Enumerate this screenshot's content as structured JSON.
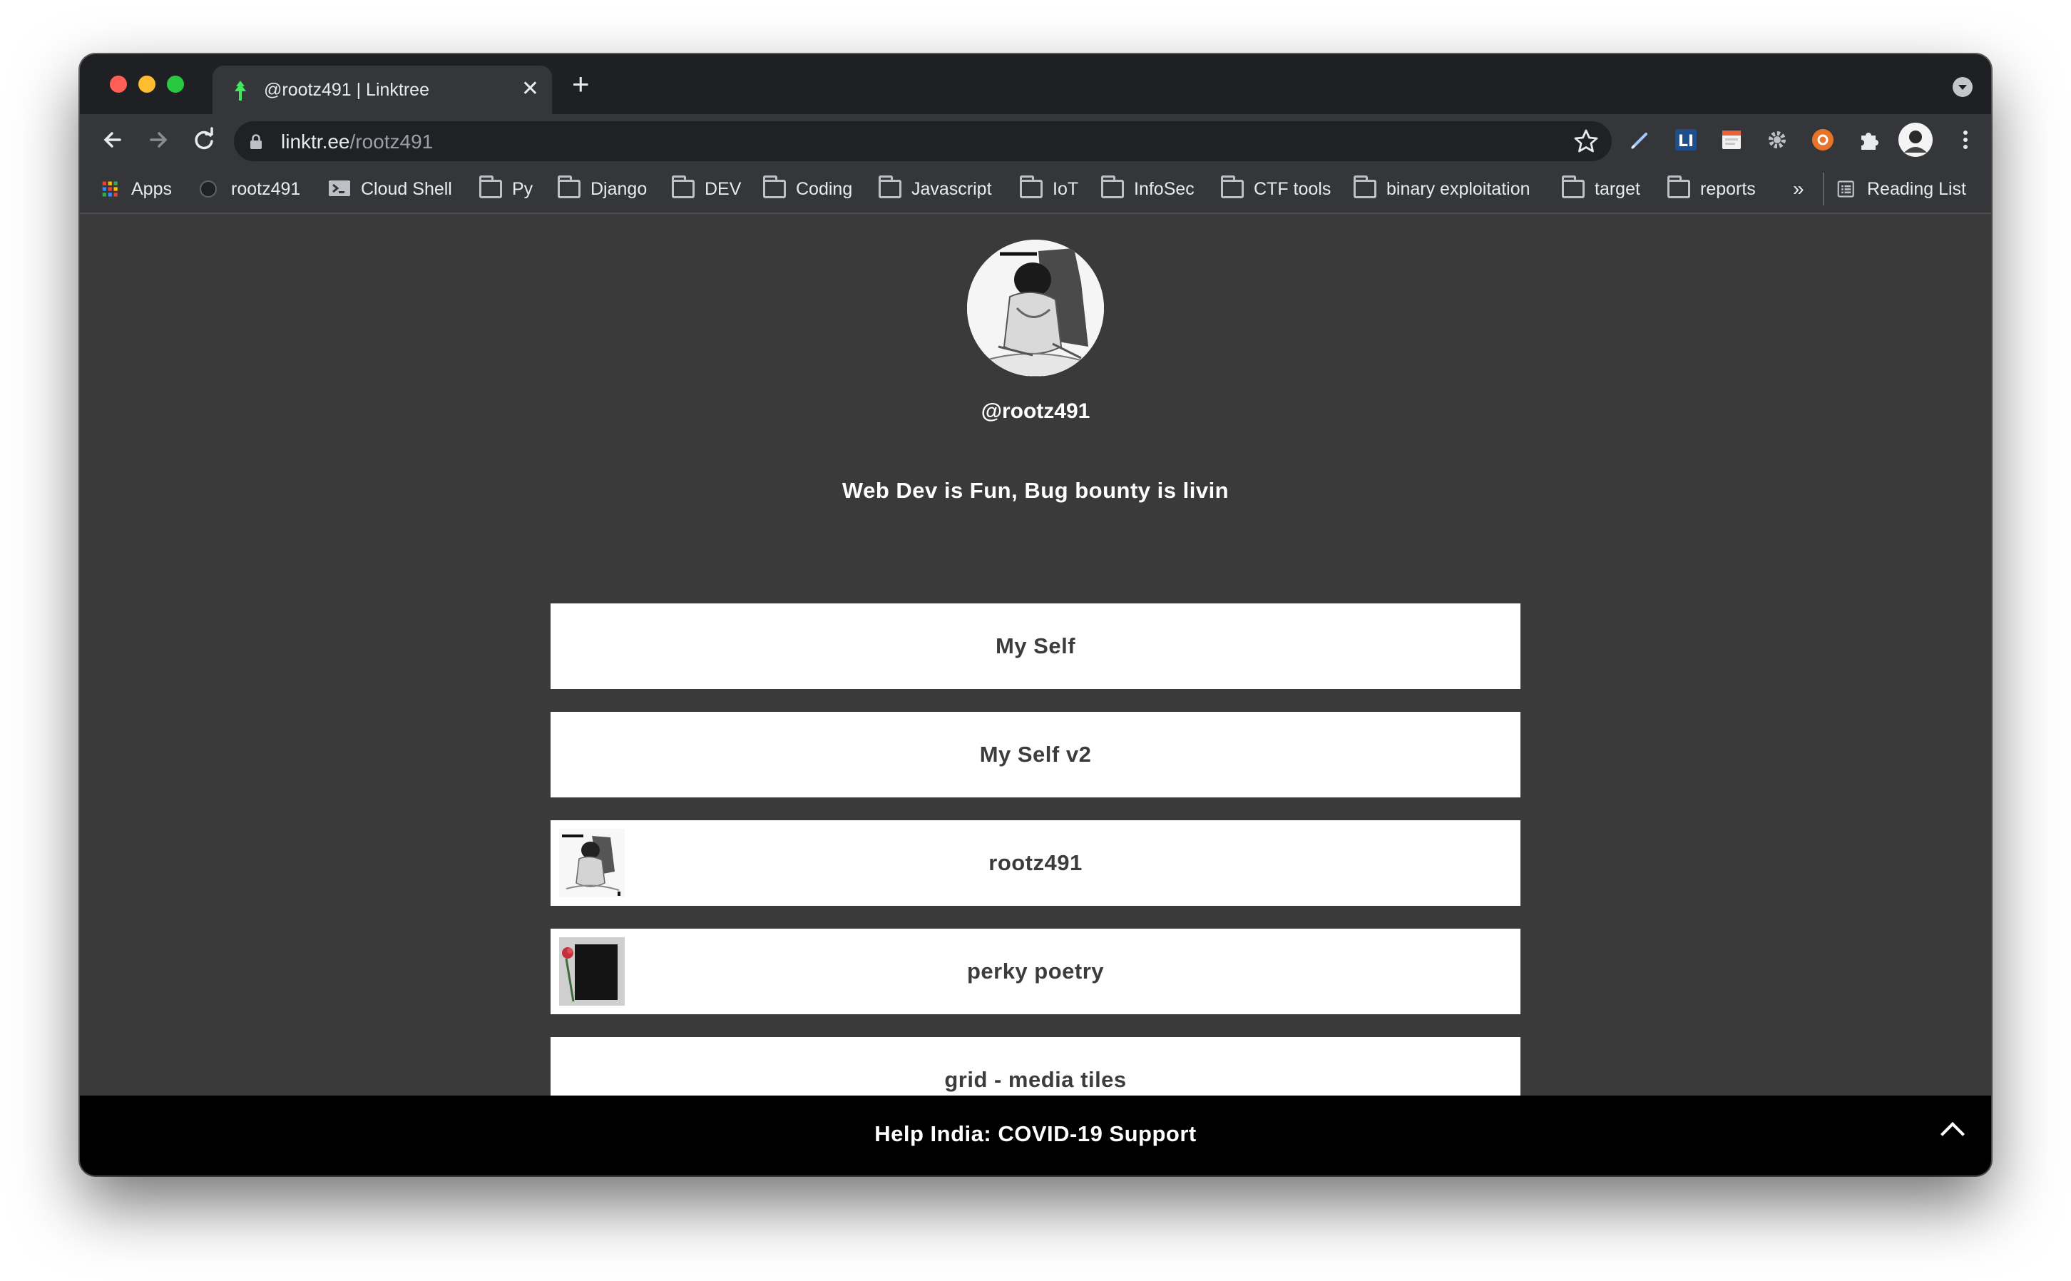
{
  "browser": {
    "tab_title": "@rootz491 | Linktree",
    "tab_close": "✕",
    "new_tab": "+",
    "url_host": "linktr.ee",
    "url_path": "/rootz491",
    "bookmarks": [
      {
        "label": "Apps",
        "icon": "apps-grid-icon"
      },
      {
        "label": "rootz491",
        "icon": "github-icon"
      },
      {
        "label": "Cloud Shell",
        "icon": "cloud-shell-icon"
      },
      {
        "label": "Py",
        "icon": "folder-icon"
      },
      {
        "label": "Django",
        "icon": "folder-icon"
      },
      {
        "label": "DEV",
        "icon": "folder-icon"
      },
      {
        "label": "Coding",
        "icon": "folder-icon"
      },
      {
        "label": "Javascript",
        "icon": "folder-icon"
      },
      {
        "label": "IoT",
        "icon": "folder-icon"
      },
      {
        "label": "InfoSec",
        "icon": "folder-icon"
      },
      {
        "label": "CTF tools",
        "icon": "folder-icon"
      },
      {
        "label": "binary exploitation",
        "icon": "folder-icon"
      },
      {
        "label": "target",
        "icon": "folder-icon"
      },
      {
        "label": "reports",
        "icon": "folder-icon"
      }
    ],
    "overflow": "»",
    "reading_list": "Reading List"
  },
  "profile": {
    "handle": "@rootz491",
    "bio": "Web Dev is Fun, Bug bounty is livin"
  },
  "links": [
    {
      "label": "My Self",
      "thumb": null
    },
    {
      "label": "My Self v2",
      "thumb": null
    },
    {
      "label": "rootz491",
      "thumb": "sketch-avatar-thumbnail"
    },
    {
      "label": "perky poetry",
      "thumb": "rose-notebook-thumbnail"
    },
    {
      "label": "grid - media tiles",
      "thumb": null
    }
  ],
  "footer": {
    "banner": "Help India: COVID-19 Support"
  },
  "colors": {
    "page_bg": "#3b3a3b",
    "link_bg": "#ffffff",
    "link_text": "#3d3b3c",
    "footer_bg": "#000000",
    "linktree_green": "#43e660"
  }
}
